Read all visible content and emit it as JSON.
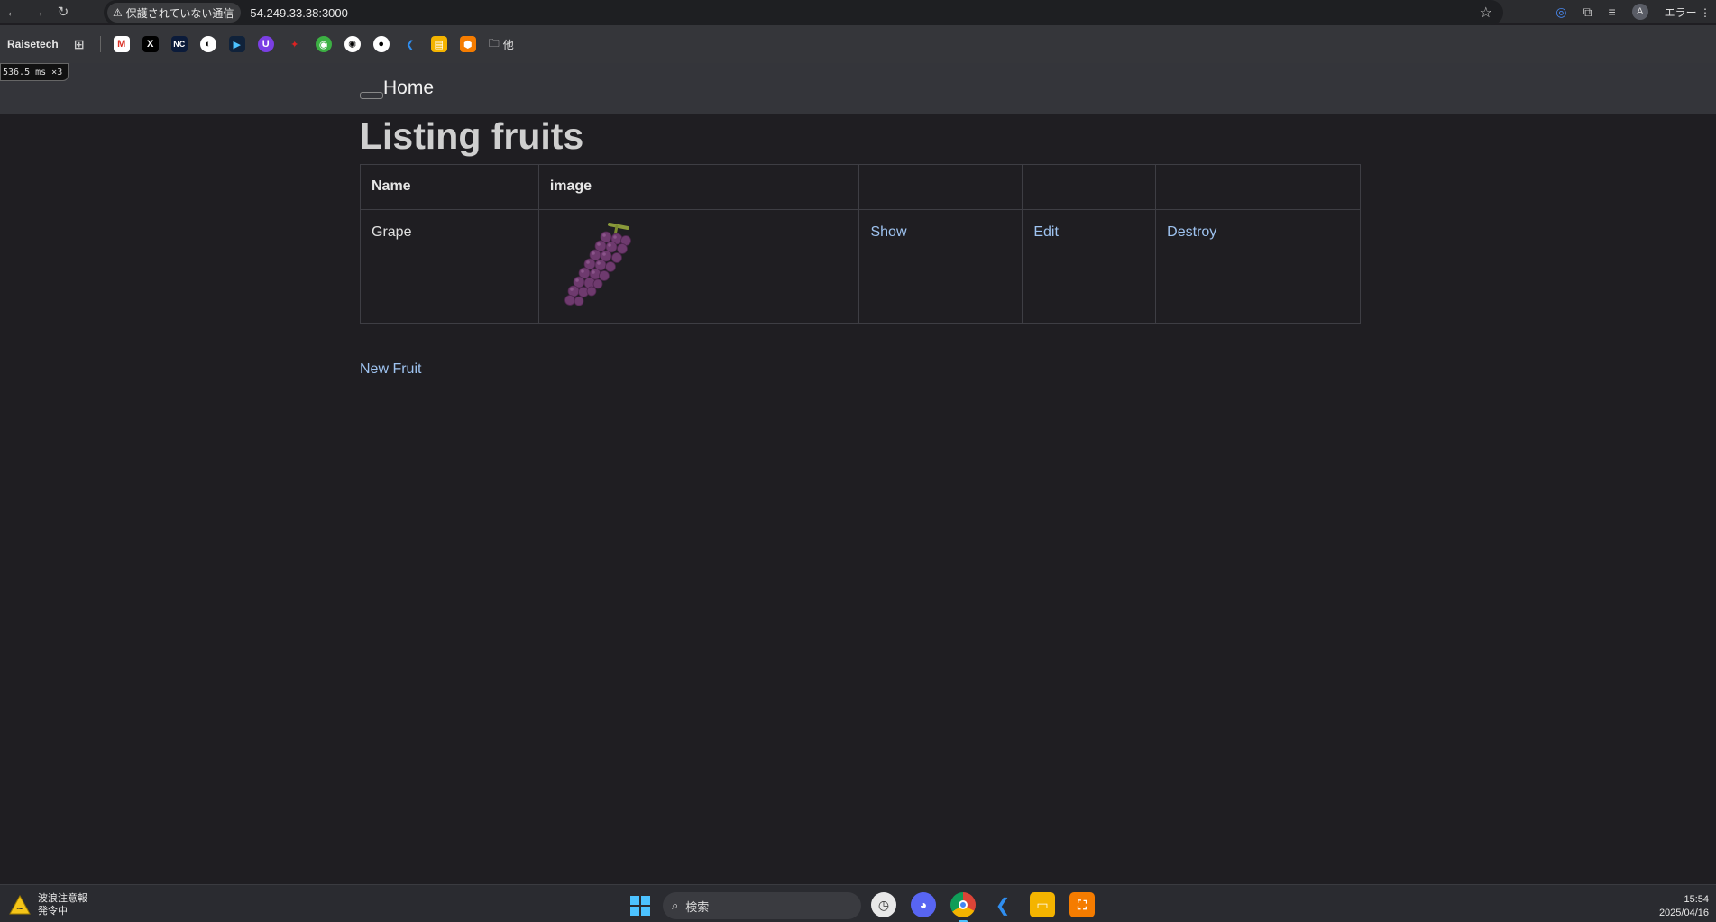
{
  "browser": {
    "security_label": "保護されていない通信",
    "url": "54.249.33.38:3000",
    "error_label": "エラー",
    "avatar_letter": "A"
  },
  "bookmarks": {
    "first_label": "Raisetech",
    "folder_label": "他"
  },
  "perf_badge": "536.5 ms ×3",
  "nav": {
    "home_label": "Home"
  },
  "page": {
    "title": "Listing fruits",
    "table": {
      "headers": [
        "Name",
        "image",
        "",
        "",
        ""
      ],
      "rows": [
        {
          "name": "Grape",
          "image": "grape",
          "show_label": "Show",
          "edit_label": "Edit",
          "destroy_label": "Destroy"
        }
      ]
    },
    "new_fruit_label": "New Fruit"
  },
  "taskbar": {
    "weather_title": "波浪注意報",
    "weather_sub": "発令中",
    "search_placeholder": "検索",
    "time": "15:54",
    "date": "2025/04/16"
  },
  "colors": {
    "page_bg": "#1f1e22",
    "nav_bg": "#34353a",
    "link": "#9ec3f0",
    "grape": "#6e3a6e"
  }
}
